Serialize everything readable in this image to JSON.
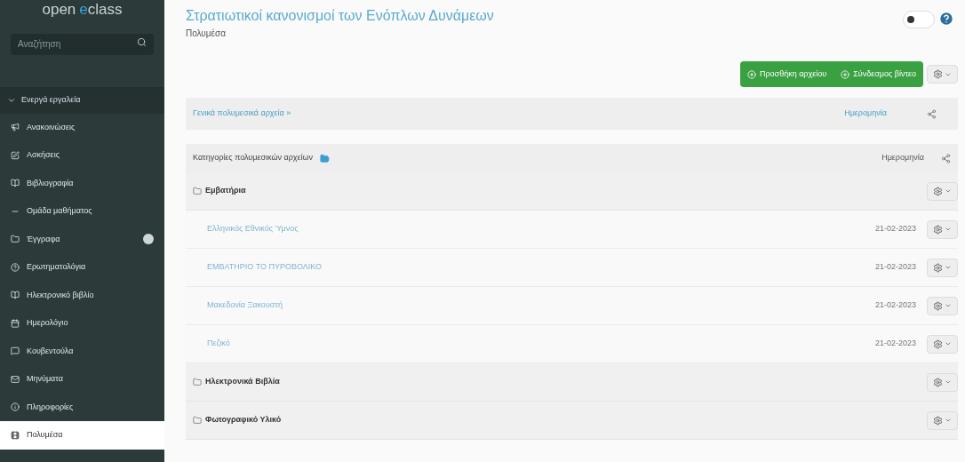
{
  "sidebar": {
    "logo": {
      "part1": "open",
      "part2": "eclass"
    },
    "search": {
      "placeholder": "Αναζήτηση"
    },
    "section": {
      "label": "Ενεργά εργαλεία",
      "expanded": true
    },
    "items": [
      {
        "label": "Ανακοινώσεις",
        "selected": false,
        "badge": false
      },
      {
        "label": "Ασκήσεις",
        "selected": false,
        "badge": false
      },
      {
        "label": "Βιβλιογραφία",
        "selected": false,
        "badge": false
      },
      {
        "label": "Ομάδα μαθήματος",
        "selected": false,
        "badge": false
      },
      {
        "label": "Έγγραφα",
        "selected": false,
        "badge": true
      },
      {
        "label": "Ερωτηματολόγια",
        "selected": false,
        "badge": false
      },
      {
        "label": "Ηλεκτρονικό βιβλίο",
        "selected": false,
        "badge": false
      },
      {
        "label": "Ημερολόγιο",
        "selected": false,
        "badge": false
      },
      {
        "label": "Κουβεντούλα",
        "selected": false,
        "badge": false
      },
      {
        "label": "Μηνύματα",
        "selected": false,
        "badge": false
      },
      {
        "label": "Πληροφορίες",
        "selected": false,
        "badge": false
      },
      {
        "label": "Πολυμέσα",
        "selected": true,
        "badge": false
      }
    ]
  },
  "header": {
    "title": "Στρατιωτικοί κανονισμοί των Ενόπλων Δυνάμεων",
    "subtitle": "Πολυμέσα",
    "toggle": {
      "on": false
    }
  },
  "actions": [
    "Προσθήκη αρχείου",
    "Σύνδεσμος βίντεο"
  ],
  "general": {
    "label": "Γενικά πολυμεσικά αρχεία »",
    "date_column": "Ημερομηνία"
  },
  "categories": {
    "heading": "Κατηγορίες πολυμεσικών αρχείων",
    "date_column": "Ημερομηνία",
    "rows": [
      {
        "kind": "category",
        "name": "Εμβατήρια",
        "children": [
          {
            "name": "Ελληνικός Εθνικός Ύμνος",
            "date": "21-02-2023"
          },
          {
            "name": "ΕΜΒΑΤΗΡΙΟ ΤΟ ΠΥΡΟΒΟΛΙΚΟ",
            "date": "21-02-2023"
          },
          {
            "name": "Μακεδονία Ξακουστή",
            "date": "21-02-2023"
          },
          {
            "name": "Πεζικό",
            "date": "21-02-2023"
          }
        ]
      },
      {
        "kind": "category",
        "name": "Ηλεκτρονικά Βιβλία",
        "children": []
      },
      {
        "kind": "category",
        "name": "Φωτογραφικό Υλικό",
        "children": []
      }
    ]
  }
}
